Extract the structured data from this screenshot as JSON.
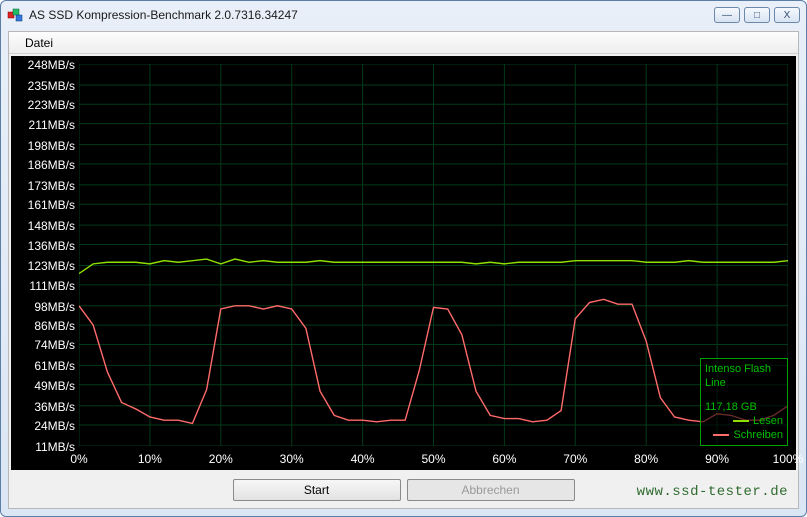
{
  "window": {
    "title": "AS SSD Kompression-Benchmark 2.0.7316.34247",
    "controls": {
      "min": "—",
      "max": "□",
      "close": "X"
    }
  },
  "menubar": {
    "items": [
      "Datei"
    ]
  },
  "buttons": {
    "start": "Start",
    "cancel": "Abbrechen"
  },
  "watermark": "www.ssd-tester.de",
  "legend": {
    "device": "Intenso Flash Line",
    "capacity": "117,18 GB",
    "read_label": "Lesen",
    "write_label": "Schreiben"
  },
  "colors": {
    "read": "#8ee000",
    "write": "#ff6a6a",
    "grid": "#003a1a",
    "bg": "#000000",
    "text": "#ffffff",
    "legend_border": "#00a000"
  },
  "chart_data": {
    "type": "line",
    "title": "",
    "xlabel": "",
    "ylabel": "",
    "x_ticks": [
      "0%",
      "10%",
      "20%",
      "30%",
      "40%",
      "50%",
      "60%",
      "70%",
      "80%",
      "90%",
      "100%"
    ],
    "y_ticks": [
      "11MB/s",
      "24MB/s",
      "36MB/s",
      "49MB/s",
      "61MB/s",
      "74MB/s",
      "86MB/s",
      "98MB/s",
      "111MB/s",
      "123MB/s",
      "136MB/s",
      "148MB/s",
      "161MB/s",
      "173MB/s",
      "186MB/s",
      "198MB/s",
      "211MB/s",
      "223MB/s",
      "235MB/s",
      "248MB/s"
    ],
    "xlim": [
      0,
      100
    ],
    "ylim": [
      11,
      248
    ],
    "x": [
      0,
      2,
      4,
      6,
      8,
      10,
      12,
      14,
      16,
      18,
      20,
      22,
      24,
      26,
      28,
      30,
      32,
      34,
      36,
      38,
      40,
      42,
      44,
      46,
      48,
      50,
      52,
      54,
      56,
      58,
      60,
      62,
      64,
      66,
      68,
      70,
      72,
      74,
      76,
      78,
      80,
      82,
      84,
      86,
      88,
      90,
      92,
      94,
      96,
      98,
      100
    ],
    "series": [
      {
        "name": "Lesen",
        "color": "#8ee000",
        "values": [
          118,
          124,
          125,
          125,
          125,
          124,
          126,
          125,
          126,
          127,
          124,
          127,
          125,
          126,
          125,
          125,
          125,
          126,
          125,
          125,
          125,
          125,
          125,
          125,
          125,
          125,
          125,
          125,
          124,
          125,
          124,
          125,
          125,
          125,
          125,
          126,
          126,
          126,
          126,
          126,
          125,
          125,
          125,
          126,
          125,
          125,
          125,
          125,
          125,
          125,
          126
        ]
      },
      {
        "name": "Schreiben",
        "color": "#ff6a6a",
        "values": [
          98,
          86,
          57,
          38,
          34,
          29,
          27,
          27,
          25,
          46,
          96,
          98,
          98,
          96,
          98,
          96,
          84,
          45,
          30,
          27,
          27,
          26,
          27,
          27,
          58,
          97,
          96,
          80,
          45,
          30,
          28,
          28,
          26,
          27,
          33,
          90,
          100,
          102,
          99,
          99,
          76,
          41,
          29,
          27,
          26,
          31,
          30,
          27,
          27,
          30,
          36
        ]
      }
    ]
  }
}
